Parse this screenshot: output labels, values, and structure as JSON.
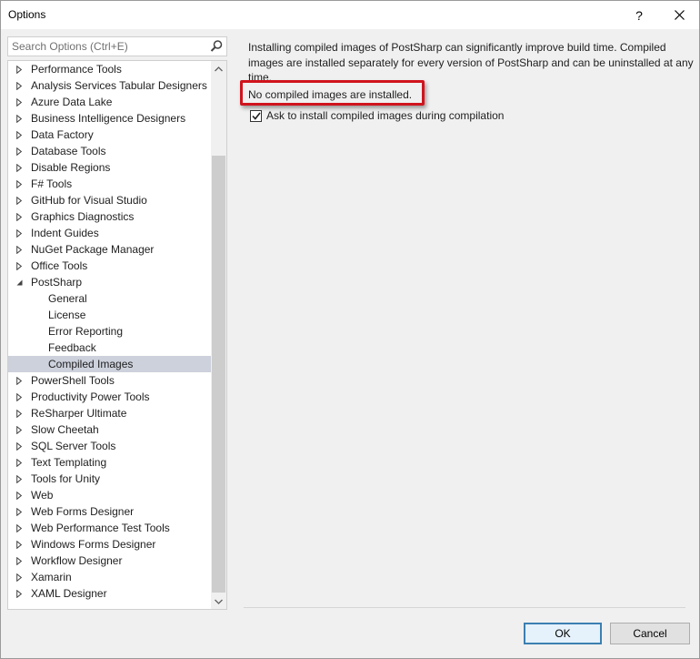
{
  "window": {
    "title": "Options",
    "help_label": "?",
    "close_label": "✕"
  },
  "search": {
    "placeholder": "Search Options (Ctrl+E)",
    "value": ""
  },
  "tree": {
    "items": [
      {
        "label": "Performance Tools",
        "type": "collapsed"
      },
      {
        "label": "Analysis Services Tabular Designers",
        "type": "collapsed"
      },
      {
        "label": "Azure Data Lake",
        "type": "collapsed"
      },
      {
        "label": "Business Intelligence Designers",
        "type": "collapsed"
      },
      {
        "label": "Data Factory",
        "type": "collapsed"
      },
      {
        "label": "Database Tools",
        "type": "collapsed"
      },
      {
        "label": "Disable Regions",
        "type": "collapsed"
      },
      {
        "label": "F# Tools",
        "type": "collapsed"
      },
      {
        "label": "GitHub for Visual Studio",
        "type": "collapsed"
      },
      {
        "label": "Graphics Diagnostics",
        "type": "collapsed"
      },
      {
        "label": "Indent Guides",
        "type": "collapsed"
      },
      {
        "label": "NuGet Package Manager",
        "type": "collapsed"
      },
      {
        "label": "Office Tools",
        "type": "collapsed"
      },
      {
        "label": "PostSharp",
        "type": "expanded"
      },
      {
        "label": "General",
        "type": "child"
      },
      {
        "label": "License",
        "type": "child"
      },
      {
        "label": "Error Reporting",
        "type": "child"
      },
      {
        "label": "Feedback",
        "type": "child"
      },
      {
        "label": "Compiled Images",
        "type": "child",
        "selected": true
      },
      {
        "label": "PowerShell Tools",
        "type": "collapsed"
      },
      {
        "label": "Productivity Power Tools",
        "type": "collapsed"
      },
      {
        "label": "ReSharper Ultimate",
        "type": "collapsed"
      },
      {
        "label": "Slow Cheetah",
        "type": "collapsed"
      },
      {
        "label": "SQL Server Tools",
        "type": "collapsed"
      },
      {
        "label": "Text Templating",
        "type": "collapsed"
      },
      {
        "label": "Tools for Unity",
        "type": "collapsed"
      },
      {
        "label": "Web",
        "type": "collapsed"
      },
      {
        "label": "Web Forms Designer",
        "type": "collapsed"
      },
      {
        "label": "Web Performance Test Tools",
        "type": "collapsed"
      },
      {
        "label": "Windows Forms Designer",
        "type": "collapsed"
      },
      {
        "label": "Workflow Designer",
        "type": "collapsed"
      },
      {
        "label": "Xamarin",
        "type": "collapsed"
      },
      {
        "label": "XAML Designer",
        "type": "collapsed"
      }
    ]
  },
  "content": {
    "description": "Installing compiled images of PostSharp can significantly improve build time. Compiled images are installed separately for every version of PostSharp and can be uninstalled at any time.",
    "status": "No compiled images are installed.",
    "ask_install_label": "Ask to install compiled images during compilation",
    "ask_install_checked": true
  },
  "buttons": {
    "ok": "OK",
    "cancel": "Cancel"
  },
  "colors": {
    "highlight_border": "#d0141d",
    "selected_row": "#cdd1dc",
    "ok_border": "#3c7fb1"
  }
}
